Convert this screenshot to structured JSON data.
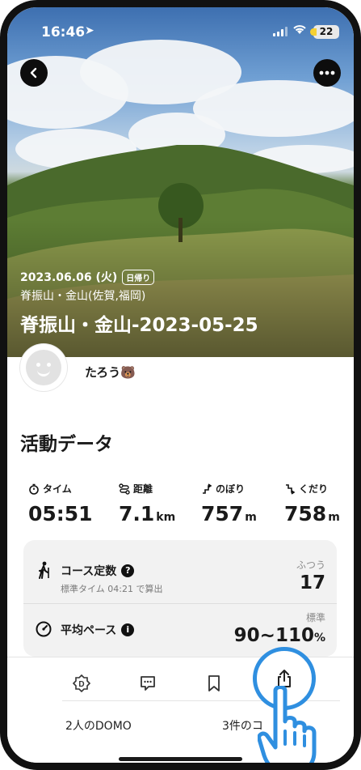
{
  "status_bar": {
    "time": "16:46",
    "battery": "22"
  },
  "hero": {
    "date": "2023.06.06 (火)",
    "tag": "日帰り",
    "area": "脊振山・金山(佐賀,福岡)",
    "title": "脊振山・金山-2023-05-25"
  },
  "user": {
    "name": "たろう🐻"
  },
  "section_title": "活動データ",
  "stats": [
    {
      "label": "タイム",
      "value": "05:51",
      "unit": "",
      "icon": "stopwatch-icon"
    },
    {
      "label": "距離",
      "value": "7.1",
      "unit": "km",
      "icon": "route-icon"
    },
    {
      "label": "のぼり",
      "value": "757",
      "unit": "m",
      "icon": "ascent-icon"
    },
    {
      "label": "くだり",
      "value": "758",
      "unit": "m",
      "icon": "descent-icon"
    }
  ],
  "course": {
    "name": "コース定数",
    "help": "?",
    "sub": "標準タイム 04:21 で算出",
    "level": "ふつう",
    "value": "17"
  },
  "pace": {
    "name": "平均ペース",
    "help": "i",
    "level": "標準",
    "value": "90~110",
    "unit": "%"
  },
  "bottom": {
    "domo_label": "2人のDOMO",
    "comment_label": "3件のコ"
  }
}
